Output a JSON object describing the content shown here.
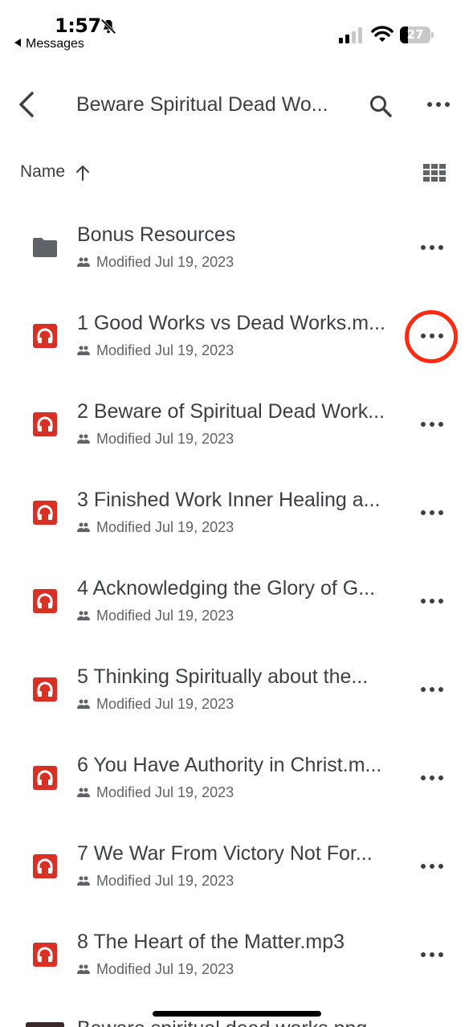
{
  "status_bar": {
    "time": "1:57",
    "back_app": "Messages",
    "battery": "27",
    "battery_level": 0.27
  },
  "app_bar": {
    "title": "Beware Spiritual Dead Wo..."
  },
  "sort": {
    "label": "Name"
  },
  "files": [
    {
      "name": "Bonus Resources",
      "meta": "Modified Jul 19, 2023",
      "type": "folder"
    },
    {
      "name": "1 Good Works vs Dead Works.m...",
      "meta": "Modified Jul 19, 2023",
      "type": "audio"
    },
    {
      "name": "2 Beware of Spiritual Dead Work...",
      "meta": "Modified Jul 19, 2023",
      "type": "audio"
    },
    {
      "name": "3 Finished Work Inner Healing a...",
      "meta": "Modified Jul 19, 2023",
      "type": "audio"
    },
    {
      "name": "4 Acknowledging the Glory of G...",
      "meta": "Modified Jul 19, 2023",
      "type": "audio"
    },
    {
      "name": "5 Thinking Spiritually about the...",
      "meta": "Modified Jul 19, 2023",
      "type": "audio"
    },
    {
      "name": "6 You Have Authority in Christ.m...",
      "meta": "Modified Jul 19, 2023",
      "type": "audio"
    },
    {
      "name": "7 We War From Victory Not For...",
      "meta": "Modified Jul 19, 2023",
      "type": "audio"
    },
    {
      "name": "8 The Heart of the Matter.mp3",
      "meta": "Modified Jul 19, 2023",
      "type": "audio"
    }
  ],
  "peek_item": "Beware spiritual dead works.png",
  "colors": {
    "audio_icon": "#d93025",
    "folder_icon": "#5f6368",
    "highlight": "#ff2a12"
  }
}
